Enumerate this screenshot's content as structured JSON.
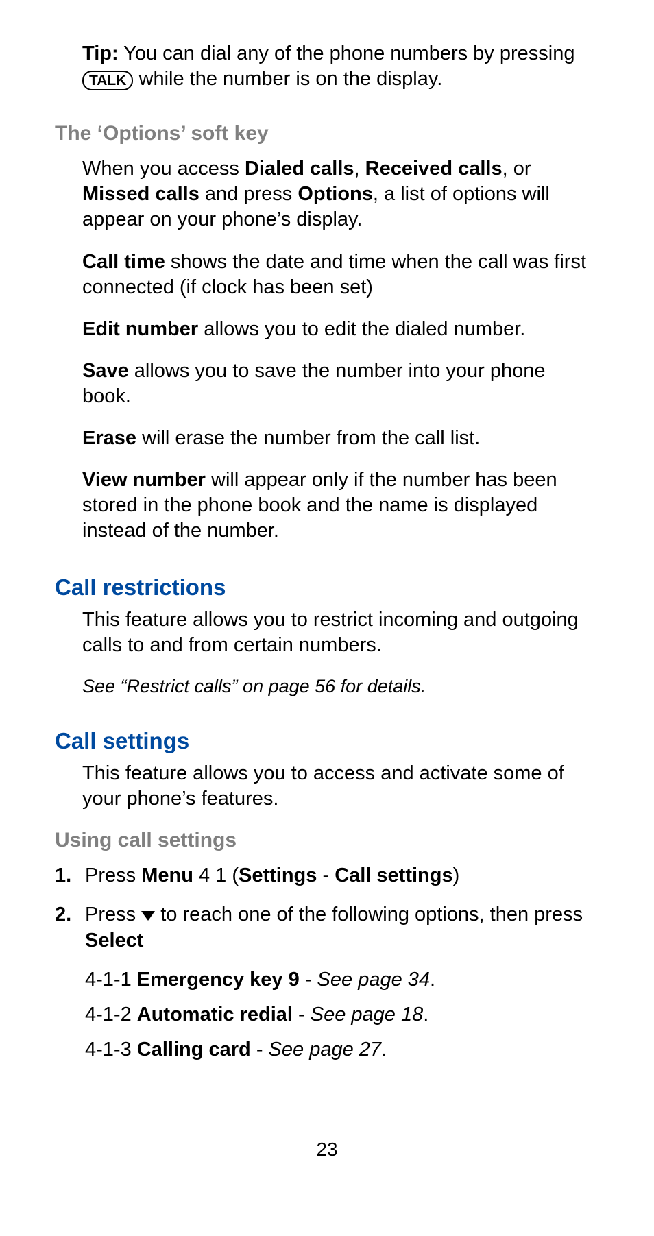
{
  "tip": {
    "label": "Tip:",
    "text_before_key": " You can dial any of the phone numbers by pressing ",
    "key_label": "TALK",
    "text_after_key": " while the number is on the display."
  },
  "options_softkey": {
    "heading": "The ‘Options’ soft key",
    "intro": {
      "t1": "When you access ",
      "dialed": "Dialed calls",
      "t2": ", ",
      "received": "Received calls",
      "t3": ", or ",
      "missed": "Missed calls",
      "t4": " and press ",
      "options": "Options",
      "t5": ", a list of options will appear on your phone’s display."
    },
    "call_time_label": "Call time",
    "call_time_text": " shows the date and time when the call was first connected (if clock has been set)",
    "edit_number_label": "Edit number",
    "edit_number_text": " allows you to edit the dialed number.",
    "save_label": "Save",
    "save_text": " allows you to save the number into your phone book.",
    "erase_label": "Erase",
    "erase_text": " will erase the number from the call list.",
    "view_number_label": "View number",
    "view_number_text": " will appear only if the number has been stored in the phone book and the name is displayed instead of the number."
  },
  "call_restrictions": {
    "heading": "Call restrictions",
    "body": "This feature allows you to restrict incoming and outgoing calls to and from certain numbers.",
    "see": "See “Restrict calls” on page 56 for details."
  },
  "call_settings": {
    "heading": "Call settings",
    "body": "This feature allows you to access and activate some of your phone’s features.",
    "using_heading": "Using call settings",
    "step1": {
      "num": "1.",
      "t1": "Press ",
      "menu": "Menu",
      "t2": " 4 1 (",
      "settings": "Settings",
      "dash": " - ",
      "cs": "Call settings",
      "t3": ")"
    },
    "step2": {
      "num": "2.",
      "t1": "Press ",
      "t2": " to reach one of the following options, then press ",
      "select": "Select"
    },
    "sub": {
      "a_pre": "4-1-1 ",
      "a_bold": "Emergency key 9",
      "a_dash": " - ",
      "a_italic": "See page 34",
      "a_dot": ".",
      "b_pre": "4-1-2 ",
      "b_bold": "Automatic redial",
      "b_dash": " - ",
      "b_italic": "See page 18",
      "b_dot": ".",
      "c_pre": "4-1-3 ",
      "c_bold": "Calling card",
      "c_dash": " - ",
      "c_italic": "See page 27",
      "c_dot": "."
    }
  },
  "page_number": "23"
}
